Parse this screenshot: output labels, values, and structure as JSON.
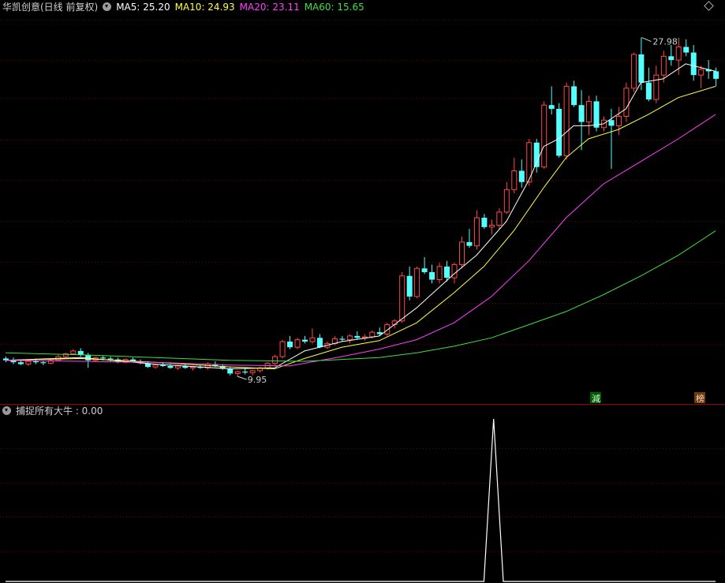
{
  "header": {
    "title": "华凯创意(日线 前复权)",
    "ma5_label": "MA5: 25.20",
    "ma10_label": "MA10: 24.93",
    "ma20_label": "MA20: 23.11",
    "ma60_label": "MA60: 15.65"
  },
  "indicator": {
    "label": "捕捉所有大牛 : 0.00"
  },
  "colors": {
    "up": "#ff4848",
    "down": "#54ffff",
    "ma5": "#ffffff",
    "ma10": "#ffff40",
    "ma20": "#ff40ff",
    "ma60": "#40e040",
    "grid": "#7a0000",
    "background": "#000000"
  },
  "chart_data": {
    "type": "candlestick",
    "price_range": [
      8.9,
      29.2
    ],
    "high_label": "27.98",
    "low_label": "9.95",
    "markers": [
      "減",
      "榜"
    ],
    "candles": [
      [
        10.9,
        11.0,
        10.7,
        10.8
      ],
      [
        10.8,
        10.95,
        10.6,
        10.7
      ],
      [
        10.7,
        10.85,
        10.55,
        10.6
      ],
      [
        10.6,
        10.8,
        10.5,
        10.75
      ],
      [
        10.75,
        10.9,
        10.6,
        10.7
      ],
      [
        10.7,
        10.8,
        10.55,
        10.65
      ],
      [
        10.65,
        10.85,
        10.6,
        10.8
      ],
      [
        10.8,
        11.1,
        10.75,
        11.0
      ],
      [
        11.0,
        11.2,
        10.95,
        11.15
      ],
      [
        11.15,
        11.4,
        11.1,
        11.3
      ],
      [
        11.3,
        11.45,
        11.0,
        11.1
      ],
      [
        11.1,
        11.2,
        10.4,
        10.8
      ],
      [
        10.8,
        11.0,
        10.7,
        10.95
      ],
      [
        10.95,
        11.05,
        10.8,
        10.9
      ],
      [
        10.9,
        11.0,
        10.75,
        10.85
      ],
      [
        10.85,
        10.95,
        10.65,
        10.7
      ],
      [
        10.7,
        10.9,
        10.65,
        10.85
      ],
      [
        10.85,
        10.95,
        10.7,
        10.75
      ],
      [
        10.75,
        10.85,
        10.6,
        10.65
      ],
      [
        10.65,
        10.75,
        10.4,
        10.45
      ],
      [
        10.45,
        10.6,
        10.35,
        10.55
      ],
      [
        10.55,
        10.65,
        10.45,
        10.5
      ],
      [
        10.5,
        10.6,
        10.35,
        10.4
      ],
      [
        10.4,
        10.55,
        10.3,
        10.5
      ],
      [
        10.5,
        10.6,
        10.35,
        10.4
      ],
      [
        10.4,
        10.5,
        10.25,
        10.45
      ],
      [
        10.45,
        10.55,
        10.35,
        10.4
      ],
      [
        10.4,
        10.7,
        10.3,
        10.6
      ],
      [
        10.6,
        10.75,
        10.45,
        10.5
      ],
      [
        10.5,
        10.6,
        10.3,
        10.35
      ],
      [
        10.35,
        10.45,
        10.0,
        10.1
      ],
      [
        10.1,
        10.25,
        9.95,
        10.2
      ],
      [
        10.2,
        10.35,
        10.05,
        10.15
      ],
      [
        10.15,
        10.3,
        10.0,
        10.25
      ],
      [
        10.25,
        10.45,
        10.15,
        10.4
      ],
      [
        10.4,
        10.7,
        10.3,
        10.65
      ],
      [
        10.65,
        11.1,
        10.55,
        11.0
      ],
      [
        11.0,
        11.9,
        10.9,
        11.8
      ],
      [
        11.8,
        12.1,
        11.4,
        11.5
      ],
      [
        11.5,
        12.0,
        11.4,
        11.9
      ],
      [
        11.9,
        12.1,
        11.7,
        11.8
      ],
      [
        11.8,
        12.5,
        11.7,
        12.0
      ],
      [
        12.0,
        12.2,
        11.45,
        11.5
      ],
      [
        11.5,
        11.8,
        11.4,
        11.7
      ],
      [
        11.7,
        12.1,
        11.6,
        11.95
      ],
      [
        11.95,
        12.1,
        11.8,
        11.9
      ],
      [
        11.9,
        12.2,
        11.7,
        12.1
      ],
      [
        12.1,
        12.35,
        11.9,
        12.0
      ],
      [
        12.0,
        12.2,
        11.85,
        12.05
      ],
      [
        12.05,
        12.4,
        11.95,
        12.3
      ],
      [
        12.3,
        12.55,
        12.1,
        12.2
      ],
      [
        12.2,
        12.8,
        12.1,
        12.7
      ],
      [
        12.7,
        13.0,
        12.5,
        12.9
      ],
      [
        12.9,
        15.5,
        12.8,
        15.3
      ],
      [
        15.3,
        15.8,
        14.0,
        14.2
      ],
      [
        14.2,
        15.8,
        14.1,
        15.7
      ],
      [
        15.7,
        16.3,
        15.4,
        15.5
      ],
      [
        15.5,
        15.9,
        14.9,
        15.1
      ],
      [
        15.1,
        16.0,
        14.9,
        15.8
      ],
      [
        15.8,
        16.1,
        15.0,
        15.2
      ],
      [
        15.2,
        16.0,
        14.9,
        15.9
      ],
      [
        15.9,
        17.4,
        15.7,
        17.1
      ],
      [
        17.1,
        17.8,
        16.8,
        16.9
      ],
      [
        16.9,
        18.8,
        16.7,
        18.4
      ],
      [
        18.4,
        18.6,
        17.8,
        17.9
      ],
      [
        17.9,
        18.3,
        17.5,
        18.0
      ],
      [
        18.0,
        18.9,
        17.8,
        18.7
      ],
      [
        18.7,
        20.3,
        18.6,
        19.9
      ],
      [
        19.9,
        21.6,
        19.7,
        20.9
      ],
      [
        20.9,
        21.5,
        20.0,
        20.3
      ],
      [
        20.3,
        22.6,
        20.1,
        22.4
      ],
      [
        22.4,
        22.6,
        20.8,
        21.1
      ],
      [
        21.1,
        24.6,
        21.0,
        24.4
      ],
      [
        24.4,
        25.4,
        23.9,
        24.2
      ],
      [
        24.2,
        24.5,
        21.6,
        21.7
      ],
      [
        21.7,
        25.6,
        21.5,
        25.4
      ],
      [
        25.4,
        25.7,
        24.3,
        24.4
      ],
      [
        24.4,
        25.2,
        22.0,
        23.5
      ],
      [
        23.5,
        24.9,
        22.8,
        24.6
      ],
      [
        24.6,
        24.9,
        23.0,
        23.2
      ],
      [
        23.2,
        23.8,
        23.0,
        23.6
      ],
      [
        23.6,
        24.2,
        21.0,
        23.3
      ],
      [
        23.3,
        24.3,
        22.8,
        23.8
      ],
      [
        23.8,
        25.6,
        23.5,
        25.3
      ],
      [
        25.3,
        27.2,
        25.1,
        27.1
      ],
      [
        27.1,
        28.0,
        25.2,
        25.6
      ],
      [
        25.6,
        26.4,
        24.6,
        24.7
      ],
      [
        24.7,
        26.5,
        24.5,
        26.0
      ],
      [
        26.0,
        27.3,
        25.6,
        27.0
      ],
      [
        27.0,
        27.6,
        26.5,
        26.8
      ],
      [
        26.8,
        28.0,
        26.0,
        27.5
      ],
      [
        27.5,
        27.9,
        27.0,
        27.2
      ],
      [
        27.2,
        27.6,
        25.7,
        26.0
      ],
      [
        26.0,
        26.5,
        25.3,
        26.3
      ],
      [
        26.3,
        26.8,
        25.8,
        26.2
      ],
      [
        26.2,
        26.4,
        25.4,
        25.8
      ]
    ],
    "ma_series": [
      {
        "name": "MA5",
        "values": [
          [
            0,
            10.8
          ],
          [
            10,
            10.95
          ],
          [
            20,
            10.6
          ],
          [
            30,
            10.35
          ],
          [
            36,
            10.4
          ],
          [
            40,
            11.3
          ],
          [
            45,
            11.8
          ],
          [
            50,
            12.1
          ],
          [
            55,
            13.6
          ],
          [
            60,
            15.4
          ],
          [
            63,
            16.4
          ],
          [
            67,
            18.2
          ],
          [
            70,
            20.4
          ],
          [
            72,
            22.2
          ],
          [
            74,
            22.6
          ],
          [
            76,
            23.3
          ],
          [
            78,
            23.3
          ],
          [
            80,
            23.4
          ],
          [
            83,
            24.2
          ],
          [
            85,
            25.6
          ],
          [
            88,
            25.8
          ],
          [
            91,
            26.6
          ],
          [
            95,
            26.2
          ]
        ]
      },
      {
        "name": "MA10",
        "values": [
          [
            0,
            10.8
          ],
          [
            10,
            10.9
          ],
          [
            20,
            10.7
          ],
          [
            30,
            10.45
          ],
          [
            36,
            10.35
          ],
          [
            40,
            10.9
          ],
          [
            45,
            11.5
          ],
          [
            50,
            11.85
          ],
          [
            55,
            12.8
          ],
          [
            60,
            14.4
          ],
          [
            64,
            15.8
          ],
          [
            68,
            17.7
          ],
          [
            72,
            20.0
          ],
          [
            75,
            21.6
          ],
          [
            78,
            22.6
          ],
          [
            82,
            23.1
          ],
          [
            86,
            23.9
          ],
          [
            90,
            24.8
          ],
          [
            95,
            25.4
          ]
        ]
      },
      {
        "name": "MA20",
        "values": [
          [
            0,
            10.8
          ],
          [
            10,
            10.75
          ],
          [
            20,
            10.7
          ],
          [
            30,
            10.55
          ],
          [
            38,
            10.5
          ],
          [
            45,
            11.0
          ],
          [
            50,
            11.4
          ],
          [
            55,
            11.9
          ],
          [
            60,
            12.8
          ],
          [
            65,
            14.2
          ],
          [
            70,
            16.1
          ],
          [
            75,
            18.4
          ],
          [
            80,
            20.2
          ],
          [
            85,
            21.4
          ],
          [
            90,
            22.6
          ],
          [
            95,
            23.9
          ]
        ]
      },
      {
        "name": "MA60",
        "values": [
          [
            0,
            11.2
          ],
          [
            10,
            11.1
          ],
          [
            20,
            10.95
          ],
          [
            30,
            10.8
          ],
          [
            40,
            10.75
          ],
          [
            50,
            10.95
          ],
          [
            55,
            11.2
          ],
          [
            60,
            11.55
          ],
          [
            65,
            12.0
          ],
          [
            70,
            12.7
          ],
          [
            75,
            13.4
          ],
          [
            80,
            14.3
          ],
          [
            85,
            15.3
          ],
          [
            90,
            16.4
          ],
          [
            95,
            17.7
          ]
        ]
      }
    ],
    "indicator_series": {
      "name": "捕捉所有大牛",
      "range": [
        0,
        1
      ],
      "values": [
        [
          0,
          0
        ],
        [
          64,
          0
        ],
        [
          65.3,
          1
        ],
        [
          66.6,
          0
        ],
        [
          95,
          0
        ]
      ]
    }
  }
}
